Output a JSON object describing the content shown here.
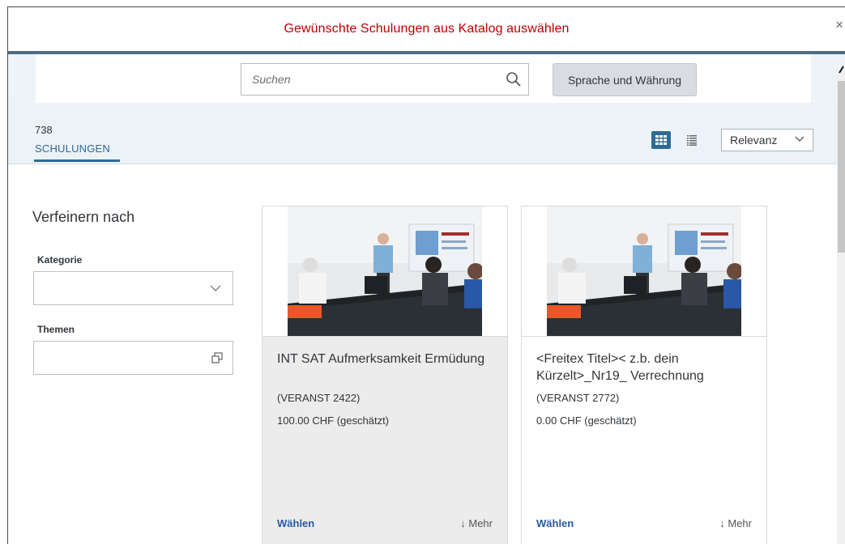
{
  "dialog": {
    "title": "Gewünschte Schulungen aus Katalog auswählen",
    "close_symbol": "×"
  },
  "search": {
    "placeholder": "Suchen",
    "value": "",
    "icon": "search-icon"
  },
  "language_button": {
    "label": "Sprache und Währung"
  },
  "results": {
    "count": "738",
    "tab_label": "SCHULUNGEN"
  },
  "view": {
    "grid_icon": "grid-view-icon",
    "list_icon": "list-view-icon",
    "active": "grid"
  },
  "sort": {
    "selected": "Relevanz"
  },
  "filters": {
    "title": "Verfeinern nach",
    "category": {
      "label": "Kategorie",
      "value": ""
    },
    "topics": {
      "label": "Themen",
      "value": ""
    }
  },
  "cards": [
    {
      "title": "INT SAT Aufmerksamkeit Ermüdung",
      "code": "(VERANST 2422)",
      "price": "100.00 CHF (geschätzt)",
      "choose": "Wählen",
      "more": "↓ Mehr"
    },
    {
      "title": "<Freitex Titel>< z.b. dein Kürzelt>_Nr19_ Verrechnung",
      "code": "(VERANST 2772)",
      "price": "0.00 CHF (geschätzt)",
      "choose": "Wählen",
      "more": "↓ Mehr"
    }
  ],
  "colors": {
    "title_red": "#bb0000",
    "accent_blue": "#2f6a96",
    "link_blue": "#2a5aa0"
  }
}
